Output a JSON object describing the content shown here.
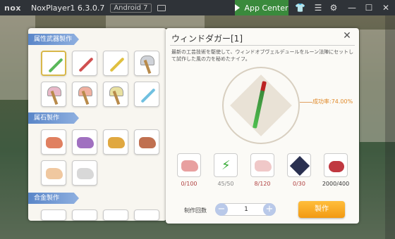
{
  "titlebar": {
    "logo": "nox",
    "title": "NoxPlayer1 6.3.0.7",
    "android": "Android 7",
    "app_center": "App Center"
  },
  "left": {
    "cat1": "属性武器製作",
    "cat2": "属石製作",
    "cat3": "合金製作"
  },
  "item": {
    "title": "ウィンドダガー[1]",
    "desc": "最新の工芸技術を駆使して、ウィンドオブヴェルデュールをルーン法陣にセットして試作した風の力を秘めたナイフ。",
    "rate": "成功率:74.00%"
  },
  "materials": [
    {
      "count": "0/100",
      "color": "#b04040"
    },
    {
      "count": "45/50",
      "color": "#888"
    },
    {
      "count": "8/120",
      "color": "#b04040"
    },
    {
      "count": "0/30",
      "color": "#b04040"
    },
    {
      "count": "2000/400",
      "color": "#333"
    }
  ],
  "craft": {
    "qty_label": "制作回数",
    "qty": "1",
    "make": "製作"
  }
}
